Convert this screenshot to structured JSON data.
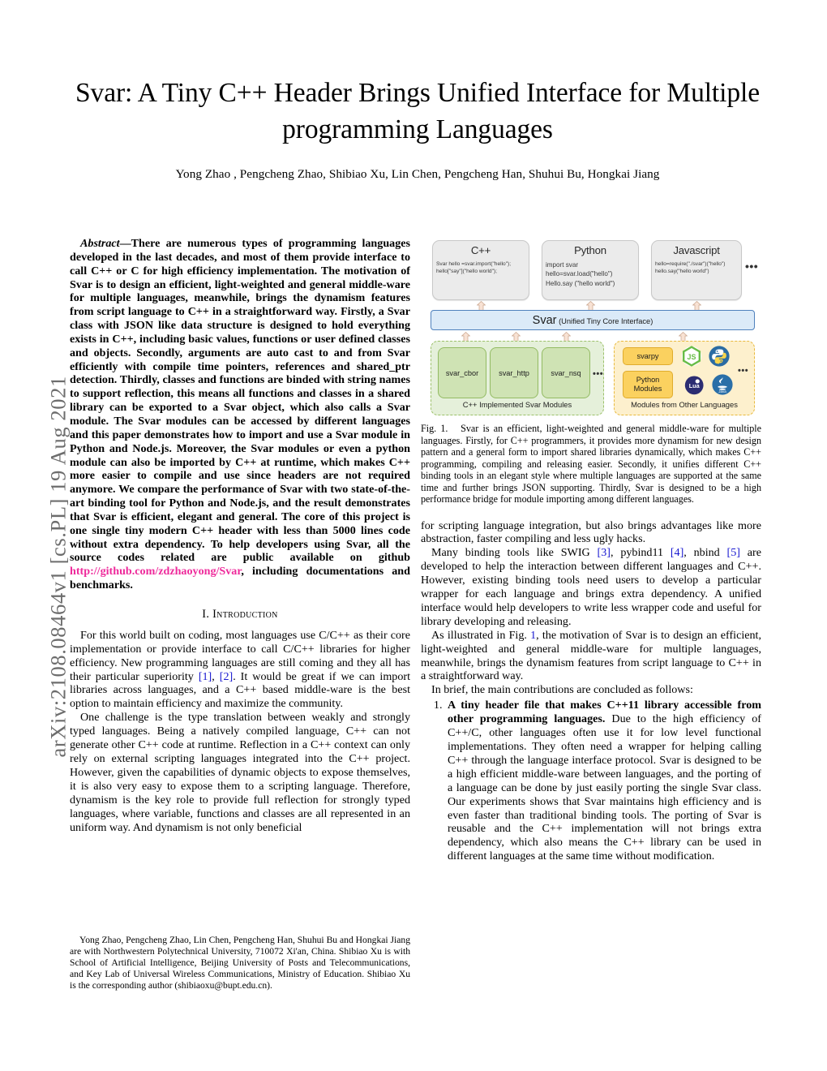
{
  "arxiv_stamp": "arXiv:2108.08464v1  [cs.PL]  19 Aug 2021",
  "title": "Svar: A Tiny C++ Header Brings Unified Interface for Multiple programming Languages",
  "authors": "Yong Zhao , Pengcheng Zhao, Shibiao Xu, Lin Chen, Pengcheng Han, Shuhui Bu, Hongkai Jiang",
  "abstract": {
    "head": "Abstract",
    "dash": "—",
    "text_before_url": "There are numerous types of programming languages developed in the last decades, and most of them provide interface to call C++ or C for high efficiency implementation. The motivation of Svar is to design an efficient, light-weighted and general middle-ware for multiple languages, meanwhile, brings the dynamism features from script language to C++ in a straightforward way. Firstly, a Svar class with JSON like data structure is designed to hold everything exists in C++, including basic values, functions or user defined classes and objects. Secondly, arguments are auto cast to and from Svar efficiently with compile time pointers, references and shared_ptr detection. Thirdly, classes and functions are binded with string names to support reflection, this means all functions and classes in a shared library can be exported to a Svar object, which also calls a Svar module. The Svar modules can be accessed by different languages and this paper demonstrates how to import and use a Svar module in Python and Node.js. Moreover, the Svar modules or even a python module can also be imported by C++ at runtime, which makes C++ more easier to compile and use since headers are not required anymore. We compare the performance of Svar with two state-of-the-art binding tool for Python and Node.js, and the result demonstrates that Svar is efficient, elegant and general. The core of this project is one single tiny modern C++ header with less than 5000 lines code without extra dependency. To help developers using Svar, all the source codes related are public available on github ",
    "url": "http://github.com/zdzhaoyong/Svar",
    "text_after_url": ", including documentations and benchmarks."
  },
  "sections": {
    "introduction_heading": "I.  Introduction"
  },
  "left_column": {
    "para1_a": "For this world built on coding, most languages use C/C++ as their core implementation or provide interface to call C/C++ libraries for higher efficiency. New programming languages are still coming and they all has their particular superiority ",
    "para1_cite1": "[1]",
    "para1_b": ", ",
    "para1_cite2": "[2]",
    "para1_c": ". It would be great if we can import libraries across languages, and a C++ based middle-ware is the best option to maintain efficiency and maximize the community.",
    "para2": "One challenge is the type translation between weakly and strongly typed languages. Being a natively compiled language, C++ can not generate other C++ code at runtime. Reflection in a C++ context can only rely on external scripting languages integrated into the C++ project. However, given the capabilities of dynamic objects to expose themselves, it is also very easy to expose them to a scripting language. Therefore, dynamism is the key role to provide full reflection for strongly typed languages, where variable, functions and classes are all represented in an uniform way. And dynamism is not only beneficial"
  },
  "right_column": {
    "para_cont": "for scripting language integration, but also brings advantages like more abstraction, faster compiling and less ugly hacks.",
    "para_tools_a": "Many binding tools like SWIG ",
    "para_tools_c3": "[3]",
    "para_tools_b": ", pybind11 ",
    "para_tools_c4": "[4]",
    "para_tools_c": ", nbind ",
    "para_tools_c5": "[5]",
    "para_tools_d": " are developed to help the interaction between different languages and C++. However, existing binding tools need users to develop a particular wrapper for each language and brings extra dependency. A unified interface would help developers to write less wrapper code and useful for library developing and releasing.",
    "para_fig_a": "As illustrated in Fig. ",
    "para_fig_ref": "1",
    "para_fig_b": ", the motivation of Svar is to design an efficient, light-weighted and general middle-ware for multiple languages, meanwhile, brings the dynamism features from script language to C++ in a straightforward way.",
    "para_brief": "In brief, the main contributions are concluded as follows:",
    "contribution_1_bold": "A tiny header file that makes C++11 library accessible from other programming languages.",
    "contribution_1_rest": " Due to the high efficiency of C++/C, other languages often use it for low level functional implementations. They often need a wrapper for helping calling C++ through the language interface protocol. Svar is designed to be a high efficient middle-ware between languages, and the porting of a language can be done by just easily porting the single Svar class. Our experiments shows that Svar maintains high efficiency and is even faster than traditional binding tools. The porting of Svar is reusable and the C++ implementation will not brings extra dependency, which also means the C++ library can be used in different languages at the same time without modification."
  },
  "figure": {
    "caption_label": "Fig. 1.",
    "caption_text": "Svar is an efficient, light-weighted and general middle-ware for multiple languages. Firstly, for C++ programmers, it provides more dynamism for new design pattern and a general form to import shared libraries dynamically, which makes C++ programming, compiling and releasing easier. Secondly, it unifies different C++ binding tools in an elegant style where multiple languages are supported at the same time and further brings JSON supporting. Thirdly, Svar is designed to be a high performance bridge for module importing among different languages.",
    "lang_boxes": [
      {
        "title": "C++",
        "code": "Svar hello =svar.import(\"hello\");\nhello[\"say\"](\"hello world\");"
      },
      {
        "title": "Python",
        "code": "import svar\nhello=svar.load(\"hello\")\nHello.say (\"hello world\")"
      },
      {
        "title": "Javascript",
        "code": "hello=require(\"./svar\")(\"hello\")\nhello.say(\"hello world\")"
      }
    ],
    "lang_more": "•••",
    "svar_bar_big": "Svar",
    "svar_bar_small": " (Unified Tiny Core Interface)",
    "cpp_modules": [
      "svar_cbor",
      "svar_http",
      "svar_nsq"
    ],
    "cpp_modules_more": "•••",
    "cpp_panel_caption": "C++ Implemented Svar Modules",
    "other_boxes": [
      "svarpy",
      "Python Modules"
    ],
    "other_more": "•••",
    "other_panel_caption": "Modules from Other Languages",
    "logos": [
      "nodejs-logo",
      "python-logo",
      "lua-logo",
      "java-logo"
    ],
    "colors": {
      "svar_bar_fill": "#dbeaf8",
      "svar_bar_border": "#4f81bd",
      "green_panel_fill": "#e5f0da",
      "green_box_fill": "#cfe3b4",
      "yellow_panel_fill": "#fdf0cd",
      "yellow_box_fill": "#fbd15f",
      "lang_box_fill": "#ebebeb",
      "arrow_fill": "#f8e2d4"
    }
  },
  "footnote": "Yong Zhao, Pengcheng Zhao, Lin Chen, Pengcheng Han, Shuhui Bu and Hongkai Jiang are with Northwestern Polytechnical University, 710072 Xi'an, China. Shibiao Xu is with School of Artificial Intelligence, Beijing University of Posts and Telecommunications, and Key Lab of Universal Wireless Communications, Ministry of Education. Shibiao Xu is the corresponding author (shibiaoxu@bupt.edu.cn)."
}
